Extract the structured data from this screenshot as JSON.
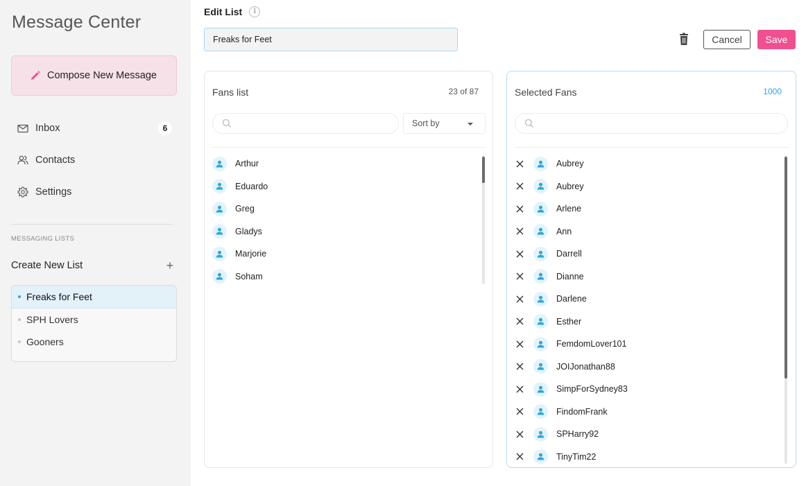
{
  "sidebar": {
    "title": "Message Center",
    "compose_label": "Compose New Message",
    "nav": [
      {
        "label": "Inbox",
        "count": "6",
        "icon": "mail-icon"
      },
      {
        "label": "Contacts",
        "icon": "contacts-icon"
      },
      {
        "label": "Settings",
        "icon": "gear-icon"
      }
    ],
    "section_label": "MESSAGING LISTS",
    "create_label": "Create New List",
    "create_plus": "+",
    "lists": [
      {
        "label": "Freaks for Feet",
        "active": true
      },
      {
        "label": "SPH Lovers",
        "active": false
      },
      {
        "label": "Gooners",
        "active": false
      }
    ]
  },
  "header": {
    "title": "Edit List",
    "info_glyph": "i",
    "list_name_value": "Freaks for Feet",
    "cancel_label": "Cancel",
    "save_label": "Save"
  },
  "fans_panel": {
    "title": "Fans list",
    "count": "23 of 87",
    "search_placeholder": "",
    "sort_label": "Sort by",
    "fans": [
      "Arthur",
      "Eduardo",
      "Greg",
      "Gladys",
      "Marjorie",
      "Soham"
    ]
  },
  "selected_panel": {
    "title": "Selected Fans",
    "count": "1000",
    "search_placeholder": "",
    "fans": [
      "Aubrey",
      "Aubrey",
      "Arlene",
      "Ann",
      "Darrell",
      "Dianne",
      "Darlene",
      "Esther",
      "FemdomLover101",
      "JOIJonathan88",
      "SimpForSydney83",
      "FindomFrank",
      "SPHarry92",
      "TinyTim22"
    ]
  },
  "colors": {
    "accent_pink": "#f0508f",
    "accent_blue": "#2aa7dc",
    "compose_bg": "#f7e1e8"
  }
}
